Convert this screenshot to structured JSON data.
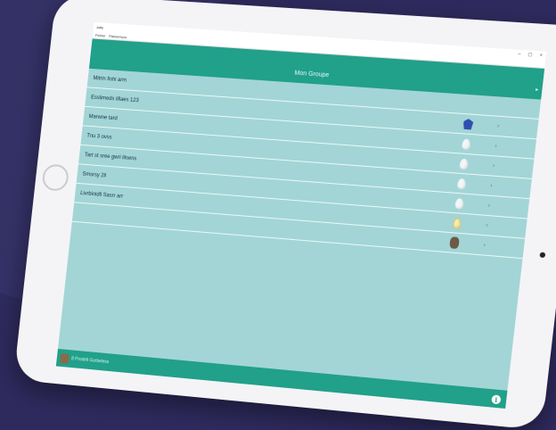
{
  "window": {
    "title": "Jaffe",
    "menu": [
      "Fichier",
      "Passerrepo"
    ],
    "controls": [
      "–",
      "▢",
      "×"
    ]
  },
  "header": {
    "title": "Mon Groupe",
    "arrow": "▸"
  },
  "rows": [
    {
      "label": "Mitrin Ilshi arm",
      "icon": "none"
    },
    {
      "label": "Esslimeds illlaes 123",
      "icon": "crest-icon"
    },
    {
      "label": "Marwne tard",
      "icon": "egg-icon"
    },
    {
      "label": "Tnu 3 ovss",
      "icon": "egg-icon"
    },
    {
      "label": "Tart st sree gwri lilsens",
      "icon": "egg-icon"
    },
    {
      "label": "Smsrsy 2ll",
      "icon": "egg-icon"
    },
    {
      "label": "Livrbinidll Sasrr arr",
      "icon": "gold-egg-icon"
    },
    {
      "label": "",
      "icon": "photo-icon"
    }
  ],
  "chevron": "›",
  "footer": {
    "user": "8 Prodell Gurbeless"
  },
  "colors": {
    "background": "#2e2a5e",
    "accent": "#21a08a",
    "list_bg": "#a3d5d6"
  }
}
